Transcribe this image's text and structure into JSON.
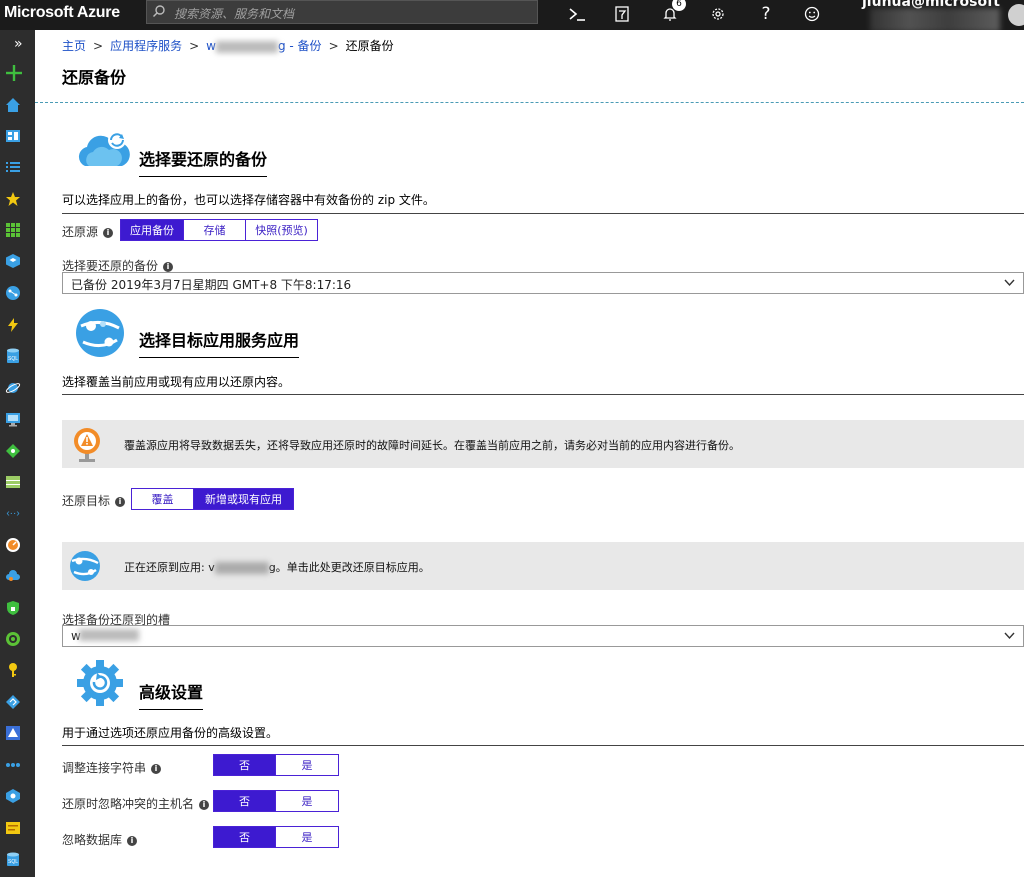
{
  "app": {
    "brand": "Microsoft Azure",
    "user": "jiuhua@microsoft",
    "notification_count": "6"
  },
  "search": {
    "placeholder": "搜索资源、服务和文档"
  },
  "breadcrumb": {
    "home": "主页",
    "app_services": "应用程序服务",
    "app_prefix": "w",
    "app_suffix": "g - 备份",
    "current": "还原备份"
  },
  "page": {
    "title": "还原备份"
  },
  "section1": {
    "title": "选择要还原的备份",
    "desc": "可以选择应用上的备份，也可以选择存储容器中有效备份的 zip 文件。",
    "source_label": "还原源",
    "source_options": [
      "应用备份",
      "存储",
      "快照(预览)"
    ],
    "backup_label": "选择要还原的备份",
    "backup_value": "已备份 2019年3月7日星期四 GMT+8 下午8:17:16"
  },
  "section2": {
    "title": "选择目标应用服务应用",
    "desc": "选择覆盖当前应用或现有应用以还原内容。",
    "warning": "覆盖源应用将导致数据丢失，还将导致应用还原时的故障时间延长。在覆盖当前应用之前，请务必对当前的应用内容进行备份。",
    "target_label": "还原目标",
    "target_options": [
      "覆盖",
      "新增或现有应用"
    ],
    "restoring_prefix": "正在还原到应用: v",
    "restoring_suffix": "g。单击此处更改还原目标应用。",
    "slot_label": "选择备份还原到的槽",
    "slot_value": "w"
  },
  "section3": {
    "title": "高级设置",
    "desc": "用于通过选项还原应用备份的高级设置。",
    "settings": [
      {
        "label": "调整连接字符串",
        "no": "否",
        "yes": "是",
        "selected": "否"
      },
      {
        "label": "还原时忽略冲突的主机名",
        "no": "否",
        "yes": "是",
        "selected": "否"
      },
      {
        "label": "忽略数据库",
        "no": "否",
        "yes": "是",
        "selected": "否"
      }
    ]
  },
  "colors": {
    "accent": "#3d1ad0",
    "link": "#1e51c7",
    "topbar": "#1b1b1b",
    "nav": "#2d2d2d"
  }
}
